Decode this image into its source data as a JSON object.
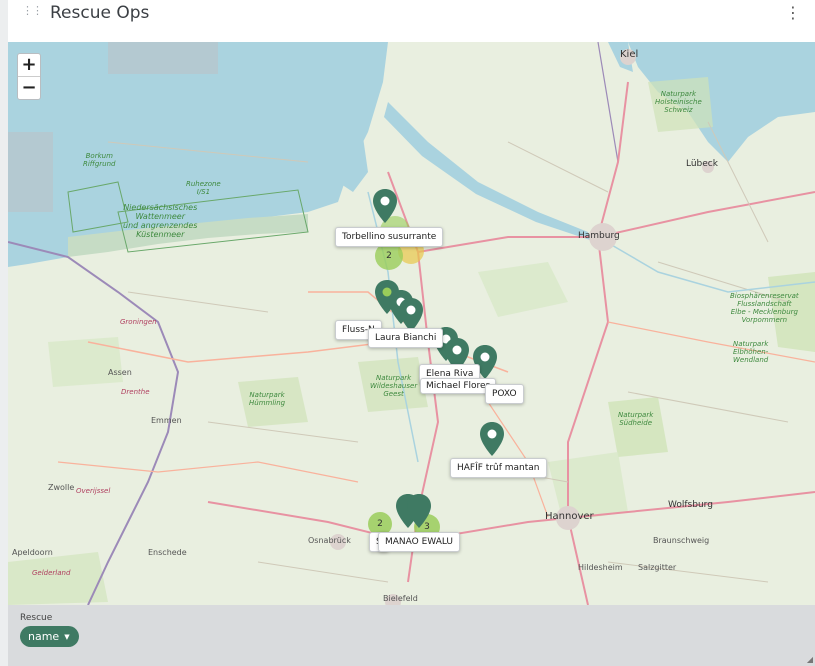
{
  "header": {
    "title": "Rescue Ops"
  },
  "map": {
    "zoom_in": "+",
    "zoom_out": "−",
    "places": {
      "kiel": "Kiel",
      "lubeck": "Lübeck",
      "hamburg": "Hamburg",
      "hannover": "Hannover",
      "wolfsburg": "Wolfsburg",
      "braunschweig": "Braunschweig",
      "hildesheim": "Hildesheim",
      "salzgitter": "Salzgitter",
      "osnabruck": "Osnabrück",
      "bielefeld": "Bielefeld",
      "enschede": "Enschede",
      "apeldoorn": "Apeldoorn",
      "assen": "Assen",
      "emmen": "Emmen",
      "groningen": "Groningen",
      "zwolle": "Zwolle",
      "drenthe": "Drenthe",
      "overijssel": "Overijssel",
      "gelderland": "Gelderland",
      "borkum": "Borkum\nRiffgrund",
      "ruhezone": "Ruhezone\nI/S1",
      "wattenmeer": "Niedersächsisches\nWattenmeer\nund angrenzendes\nKüstenmeer",
      "holstein": "Naturpark\nHolsteinische\nSchweiz",
      "biosphere": "Biosphärenreservat\nFlusslandschaft\nElbe - Mecklenburg\nVorpommern",
      "elbhohen": "Naturpark\nElbhöhen-\nWendland",
      "sudheide": "Naturpark\nSüdheide",
      "wildeshauser": "Naturpark\nWildeshauser\nGeest",
      "hummling": "Naturpark\nHümmling"
    },
    "labels": {
      "torbellino": "Torbellino susurrante",
      "fluss": "Fluss-N",
      "laura": "Laura Bianchi",
      "elena": "Elena Riva",
      "michael": "Michael Flores",
      "poxo": "POXO",
      "hafif": "HAFÎF trûf mantan",
      "s": "S",
      "manao": "MANAO EWALU"
    },
    "clusters": {
      "c1": "2",
      "c2": "2",
      "c3": "3"
    },
    "colors": {
      "pin": "#3f7a63",
      "cluster_green": "#9acd5a",
      "cluster_yellow": "#e8c74a",
      "water": "#aad3df"
    }
  },
  "footer": {
    "label": "Rescue",
    "chip": "name"
  }
}
